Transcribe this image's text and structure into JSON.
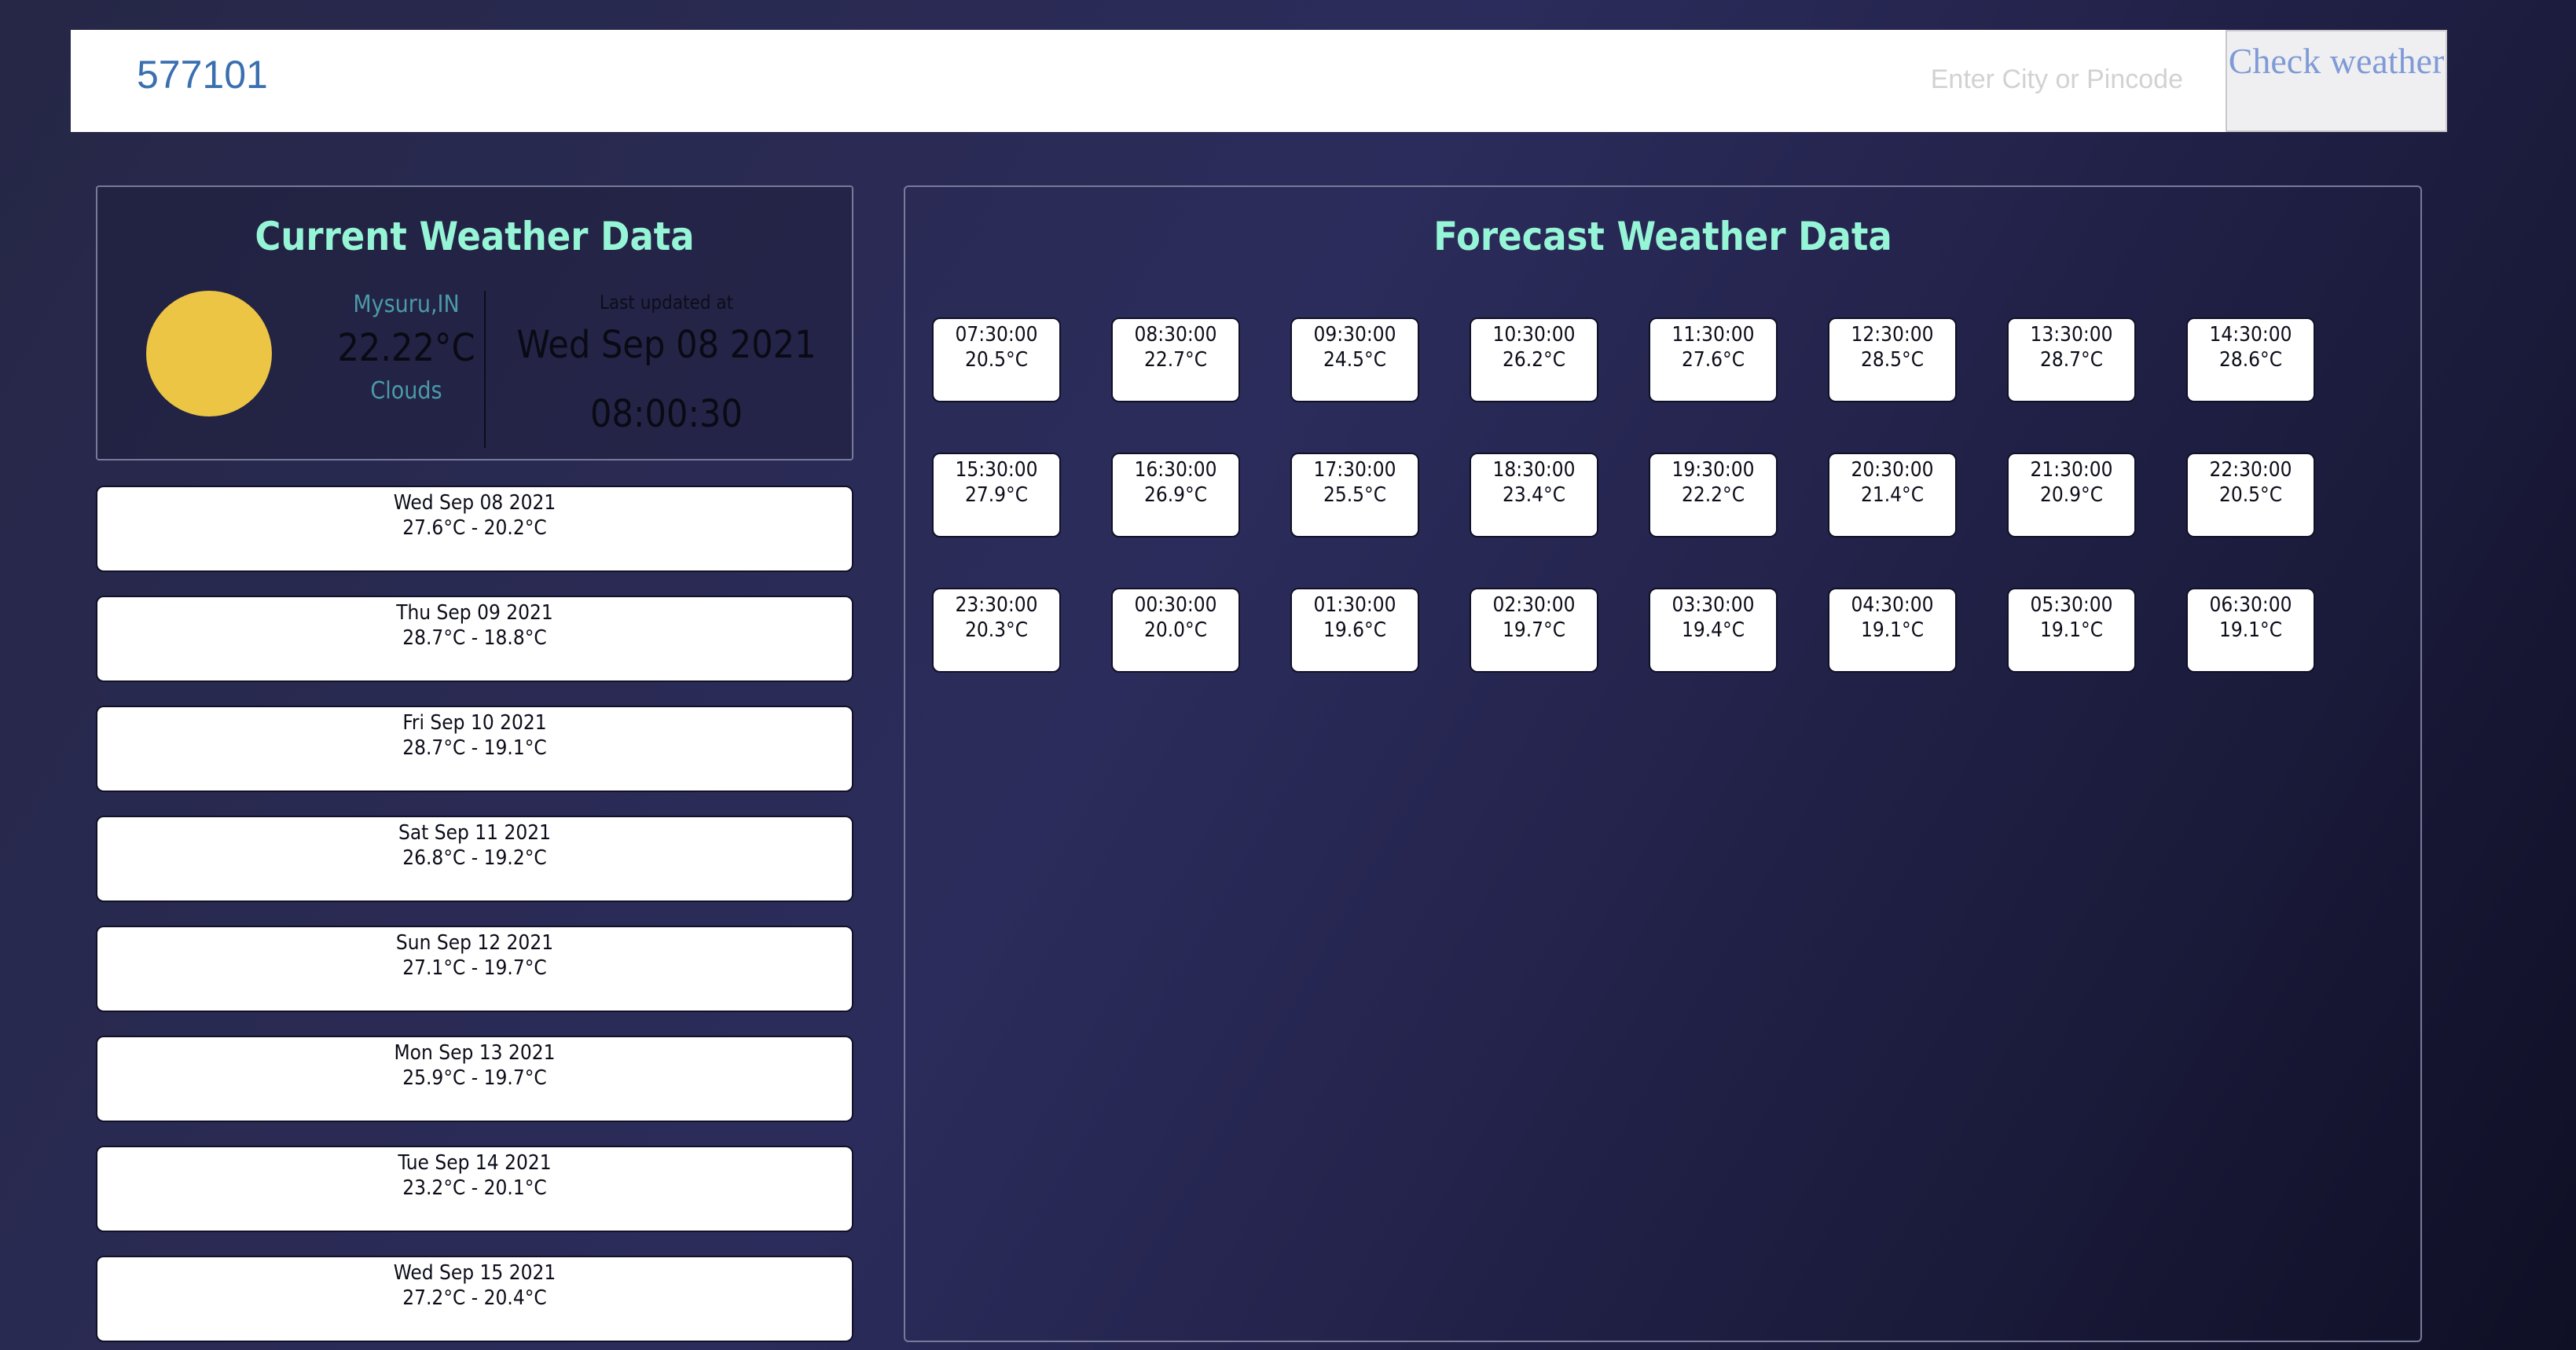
{
  "search": {
    "value": "577101",
    "placeholder": "Enter City or Pincode",
    "button_label": "Check weather"
  },
  "current": {
    "title": "Current Weather Data",
    "icon": "sun-icon",
    "city": "Mysuru,IN",
    "temperature": "22.22°C",
    "description": "Clouds",
    "last_updated_label": "Last updated at",
    "date": "Wed Sep 08 2021",
    "time": "08:00:30"
  },
  "daily": [
    {
      "date": "Wed Sep 08 2021",
      "range": "27.6°C - 20.2°C"
    },
    {
      "date": "Thu Sep 09 2021",
      "range": "28.7°C - 18.8°C"
    },
    {
      "date": "Fri Sep 10 2021",
      "range": "28.7°C - 19.1°C"
    },
    {
      "date": "Sat Sep 11 2021",
      "range": "26.8°C - 19.2°C"
    },
    {
      "date": "Sun Sep 12 2021",
      "range": "27.1°C - 19.7°C"
    },
    {
      "date": "Mon Sep 13 2021",
      "range": "25.9°C - 19.7°C"
    },
    {
      "date": "Tue Sep 14 2021",
      "range": "23.2°C - 20.1°C"
    },
    {
      "date": "Wed Sep 15 2021",
      "range": "27.2°C - 20.4°C"
    }
  ],
  "forecast": {
    "title": "Forecast Weather Data",
    "hours": [
      {
        "time": "07:30:00",
        "temp": "20.5°C"
      },
      {
        "time": "08:30:00",
        "temp": "22.7°C"
      },
      {
        "time": "09:30:00",
        "temp": "24.5°C"
      },
      {
        "time": "10:30:00",
        "temp": "26.2°C"
      },
      {
        "time": "11:30:00",
        "temp": "27.6°C"
      },
      {
        "time": "12:30:00",
        "temp": "28.5°C"
      },
      {
        "time": "13:30:00",
        "temp": "28.7°C"
      },
      {
        "time": "14:30:00",
        "temp": "28.6°C"
      },
      {
        "time": "15:30:00",
        "temp": "27.9°C"
      },
      {
        "time": "16:30:00",
        "temp": "26.9°C"
      },
      {
        "time": "17:30:00",
        "temp": "25.5°C"
      },
      {
        "time": "18:30:00",
        "temp": "23.4°C"
      },
      {
        "time": "19:30:00",
        "temp": "22.2°C"
      },
      {
        "time": "20:30:00",
        "temp": "21.4°C"
      },
      {
        "time": "21:30:00",
        "temp": "20.9°C"
      },
      {
        "time": "22:30:00",
        "temp": "20.5°C"
      },
      {
        "time": "23:30:00",
        "temp": "20.3°C"
      },
      {
        "time": "00:30:00",
        "temp": "20.0°C"
      },
      {
        "time": "01:30:00",
        "temp": "19.6°C"
      },
      {
        "time": "02:30:00",
        "temp": "19.7°C"
      },
      {
        "time": "03:30:00",
        "temp": "19.4°C"
      },
      {
        "time": "04:30:00",
        "temp": "19.1°C"
      },
      {
        "time": "05:30:00",
        "temp": "19.1°C"
      },
      {
        "time": "06:30:00",
        "temp": "19.1°C"
      }
    ]
  },
  "colors": {
    "title_accent": "#96f5d6",
    "sun": "#ecc544",
    "city_text": "#4b9aa8"
  }
}
